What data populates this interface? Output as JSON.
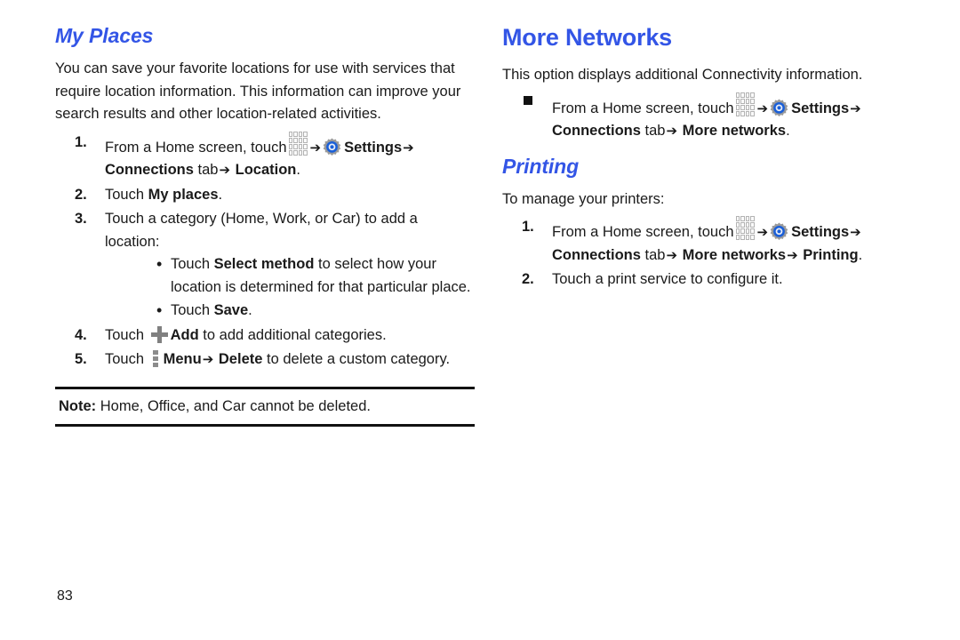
{
  "page": {
    "number": "83",
    "colors": {
      "heading_blue": "#3355e6",
      "body_text": "#1a1a1a",
      "icon_gray": "#808080",
      "rule_black": "#111111"
    }
  },
  "left_column": {
    "heading": "My Places",
    "intro": "You can save your favorite locations for use with services that require location information. This information can improve your search results and other location-related activities.",
    "steps": [
      {
        "marker": "1.",
        "pre": "From a Home screen, touch",
        "icons": [
          "apps-grid-icon",
          "arrow-right",
          "settings-gear-icon"
        ],
        "bold_1": "Settings",
        "arrow_1": "➔",
        "bold_2": "Connections",
        "mid": "tab",
        "arrow_2": "➔",
        "bold_3": "Location",
        "period": "."
      },
      {
        "marker": "2.",
        "pre": "Touch",
        "bold_1": "My places",
        "period": "."
      },
      {
        "marker": "3.",
        "text": "Touch a category (Home, Work, or Car) to add a location:",
        "sub_bullets": [
          {
            "pre": "Touch",
            "bold": "Select method",
            "post": "to select how your location is determined for that particular place."
          },
          {
            "pre": "Touch",
            "bold": "Save",
            "post": "."
          }
        ]
      },
      {
        "marker": "4.",
        "pre": "Touch",
        "icon": "plus-icon",
        "bold_1": "Add",
        "post": "to add additional categories."
      },
      {
        "marker": "5.",
        "pre": "Touch",
        "icon": "overflow-menu-icon",
        "bold_1": "Menu",
        "arrow_1": "➔",
        "bold_2": "Delete",
        "post": "to delete a custom category."
      }
    ],
    "note": {
      "label": "Note:",
      "text": "Home, Office, and Car cannot be deleted."
    }
  },
  "right_column": {
    "heading": "More Networks",
    "intro": "This option displays additional Connectivity information.",
    "bullet": {
      "marker": "square-bullet",
      "pre": "From a Home screen, touch",
      "icons": [
        "apps-grid-icon",
        "arrow-right",
        "settings-gear-icon"
      ],
      "bold_1": "Settings",
      "arrow_1": "➔",
      "bold_2": "Connections",
      "mid": "tab",
      "arrow_2": "➔",
      "bold_3": "More networks",
      "period": "."
    },
    "printing": {
      "heading": "Printing",
      "intro": "To manage your printers:",
      "steps": [
        {
          "marker": "1.",
          "pre": "From a Home screen, touch",
          "icons": [
            "apps-grid-icon",
            "arrow-right",
            "settings-gear-icon"
          ],
          "bold_1": "Settings",
          "arrow_1": "➔",
          "bold_2": "Connections",
          "mid": "tab",
          "arrow_2": "➔",
          "bold_3": "More networks",
          "arrow_3": "➔",
          "bold_4": "Printing",
          "period": "."
        },
        {
          "marker": "2.",
          "text": "Touch a print service to configure it."
        }
      ]
    }
  }
}
